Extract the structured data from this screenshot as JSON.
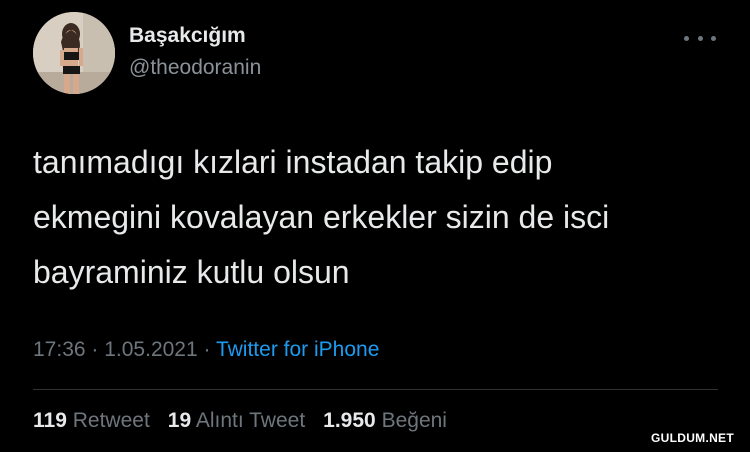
{
  "tweet": {
    "display_name": "Başakcığım",
    "handle": "@theodoranin",
    "text": "tanımadıgı kızlari instadan takip edip\nekmegini kovalayan erkekler sizin de isci\nbayraminiz kutlu olsun",
    "time": "17:36",
    "separator": " · ",
    "date": "1.05.2021",
    "source": "Twitter for iPhone"
  },
  "stats": {
    "retweets_count": "119",
    "retweets_label": "Retweet",
    "quotes_count": "19",
    "quotes_label": "Alıntı Tweet",
    "likes_count": "1.950",
    "likes_label": "Beğeni"
  },
  "watermark": "GULDUM.NET",
  "colors": {
    "background": "#000000",
    "text": "#e7e9ea",
    "muted": "#6e767d",
    "link": "#1d9bf0",
    "divider": "#2f3336"
  },
  "icons": {
    "more": "more-horizontal-icon"
  }
}
